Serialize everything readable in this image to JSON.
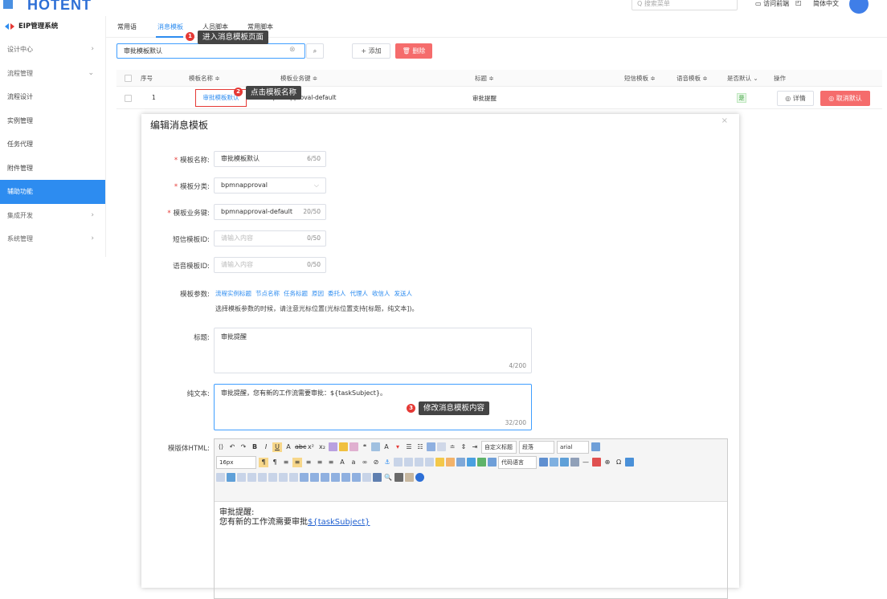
{
  "top": {
    "logo": "HOTENT",
    "search_placeholder": "Q 搜索菜单",
    "visit_frontend": "访问前端",
    "language": "简体中文"
  },
  "sidebar": {
    "brand": "EIP管理系统",
    "items": [
      {
        "label": "设计中心",
        "arrow": "›"
      },
      {
        "label": "流程管理",
        "arrow": "⌄"
      },
      {
        "label": "流程设计",
        "arrow": ""
      },
      {
        "label": "实例管理",
        "arrow": ""
      },
      {
        "label": "任务代理",
        "arrow": ""
      },
      {
        "label": "附件管理",
        "arrow": ""
      },
      {
        "label": "辅助功能",
        "arrow": ""
      },
      {
        "label": "集成开发",
        "arrow": "›"
      },
      {
        "label": "系统管理",
        "arrow": "›"
      }
    ]
  },
  "tabs": [
    "常用语",
    "消息模板",
    "人员脚本",
    "常用脚本"
  ],
  "callouts": [
    {
      "num": "1",
      "text": "进入消息模板页面"
    },
    {
      "num": "2",
      "text": "点击模板名称"
    },
    {
      "num": "3",
      "text": "修改消息模板内容"
    }
  ],
  "filter": {
    "value": "审批模板默认",
    "add": "+ 添加",
    "delete": "删除"
  },
  "table": {
    "headers": [
      "序号",
      "模板名称 ≑",
      "模板业务键 ≑",
      "标题 ≑",
      "短信模板 ≑",
      "语音模板 ≑",
      "是否默认 ⌄",
      "操作"
    ],
    "row": {
      "index": "1",
      "name": "审批模板默认",
      "key": "bpmnapproval-default",
      "title": "审批提醒",
      "is_default": "是",
      "detail": "◎ 详情",
      "cancel_default": "◎ 取消默认"
    }
  },
  "dialog": {
    "title": "编辑消息模板",
    "close": "×",
    "fields": {
      "name_label": "模板名称:",
      "name_value": "审批模板默认",
      "name_count": "6/50",
      "category_label": "模板分类:",
      "category_value": "bpmnapproval",
      "key_label": "模板业务键:",
      "key_value": "bpmnapproval-default",
      "key_count": "20/50",
      "sms_label": "短信模板ID:",
      "sms_placeholder": "请输入内容",
      "sms_count": "0/50",
      "voice_label": "语音模板ID:",
      "voice_placeholder": "请输入内容",
      "voice_count": "0/50",
      "params_label": "模板参数:",
      "params": [
        "流程实例标题",
        "节点名称",
        "任务标题",
        "原因",
        "委托人",
        "代理人",
        "收信人",
        "发送人"
      ],
      "params_hint": "选择模板参数的时候，请注意光标位置(光标位置支持[标题，纯文本])。",
      "title_label": "标题:",
      "title_value": "审批提醒",
      "title_count": "4/200",
      "plain_label": "纯文本:",
      "plain_value": "审批提醒，您有新的工作流需要审批：${taskSubject}。",
      "plain_count": "32/200",
      "html_label": "模版体HTML:"
    },
    "editor": {
      "select_custom_title": "自定义标题",
      "select_paragraph": "段落",
      "select_font": "arial",
      "select_size": "16px",
      "select_code": "代码语言",
      "body_line1": "审批提醒:",
      "body_line2": "您有新的工作流需要审批",
      "body_var": "${taskSubject}"
    }
  },
  "colors": {
    "primary": "#2d8cf0",
    "danger": "#f56c6c",
    "callout_bg": "#444444",
    "badge": "#e53935"
  }
}
